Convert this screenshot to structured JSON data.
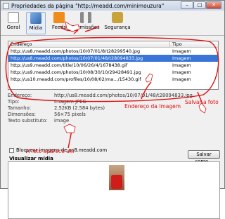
{
  "window": {
    "title": "Propriedades da página \"http://meadd.com/minimouzura\""
  },
  "toolbar": {
    "tabs": [
      {
        "label": "Geral",
        "icon": "page-icon"
      },
      {
        "label": "Mídia",
        "icon": "media-icon"
      },
      {
        "label": "Feeds",
        "icon": "rss-icon"
      },
      {
        "label": "Permissões",
        "icon": "permissions-icon"
      },
      {
        "label": "Segurança",
        "icon": "lock-icon"
      }
    ]
  },
  "media_list": {
    "columns": [
      "Endereço",
      "Tipo"
    ],
    "rows": [
      {
        "address": "http://us8.meadd.com/photos/10/07/01/8/t28299540.jpg",
        "type": "Imagem"
      },
      {
        "address": "http://us8.meadd.com/photos/10/07/01/48/t28094833.jpg",
        "type": "Imagem",
        "selected": true
      },
      {
        "address": "http://us9.meadd.com/title/10/06/26/4/1678438.gif",
        "type": "Imagem"
      },
      {
        "address": "http://us9.meadd.com/photos/10/08/30/10/29428491.jpg",
        "type": "Imagem"
      },
      {
        "address": "http://us10.meadd.com/profiles/10/08/02/ma.../15430.gif",
        "type": "Imagem"
      }
    ]
  },
  "properties": {
    "address_label": "Endereço:",
    "address_value": "http://us8.meadd.com/photos/10/07/01/48/t28094833.jpg",
    "type_label": "Tipo:",
    "type_value": "Imagem JPEG",
    "size_label": "Tamanho:",
    "size_value": "2,52KB (2.584 bytes)",
    "dimensions_label": "Dimensões:",
    "dimensions_value": "56×75 pixels",
    "alt_label": "Texto substituto:",
    "alt_value": "image"
  },
  "block_checkbox": {
    "label": "Bloquear imagens de us8.meadd.com"
  },
  "save_button": {
    "label": "Salvar como..."
  },
  "preview": {
    "label": "Visualizar mídia"
  },
  "annotations": {
    "address_note": "Endereço da Imagem",
    "save_note": "Salvar a foto",
    "photo_note": "A foto aparece aki",
    "color": "#e01010"
  }
}
